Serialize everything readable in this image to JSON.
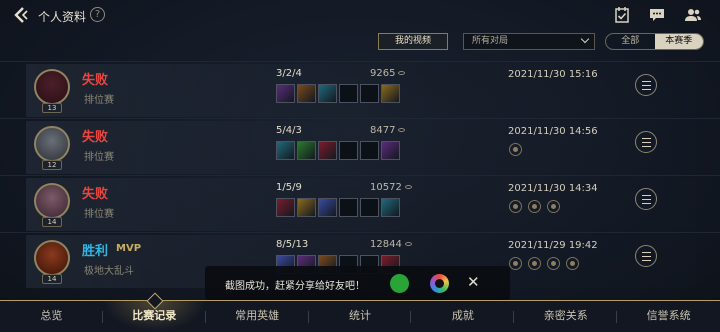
{
  "header": {
    "title": "个人资料",
    "help_icon": "?"
  },
  "top_icons": [
    "calendar-check-icon",
    "message-icon",
    "friends-icon"
  ],
  "filters": {
    "my_videos": "我的视频",
    "match_filter": "所有对局",
    "season_options": [
      "全部",
      "本赛季"
    ],
    "season_selected": "本赛季"
  },
  "matches": [
    {
      "result": "失败",
      "result_type": "loss",
      "mvp": "",
      "mode": "排位赛",
      "level": "13",
      "kda": "3/2/4",
      "gold": "9265",
      "date": "2021/11/30 15:16",
      "items_filled": 3,
      "rune_count": 0,
      "avatar_colors": [
        "#4b1f2a",
        "#2a0e14"
      ]
    },
    {
      "result": "失败",
      "result_type": "loss",
      "mvp": "",
      "mode": "排位赛",
      "level": "12",
      "kda": "5/4/3",
      "gold": "8477",
      "date": "2021/11/30 14:56",
      "items_filled": 3,
      "rune_count": 1,
      "avatar_colors": [
        "#6a6f77",
        "#2c3038"
      ]
    },
    {
      "result": "失败",
      "result_type": "loss",
      "mvp": "",
      "mode": "排位赛",
      "level": "14",
      "kda": "1/5/9",
      "gold": "10572",
      "date": "2021/11/30 14:34",
      "items_filled": 3,
      "rune_count": 3,
      "avatar_colors": [
        "#7a5a66",
        "#3a2430"
      ]
    },
    {
      "result": "胜利",
      "result_type": "win",
      "mvp": "MVP",
      "mode": "极地大乱斗",
      "level": "14",
      "kda": "8/5/13",
      "gold": "12844",
      "date": "2021/11/29 19:42",
      "items_filled": 3,
      "rune_count": 4,
      "avatar_colors": [
        "#8a3a1c",
        "#3a1208"
      ]
    }
  ],
  "toast": {
    "text": "截图成功，赶紧分享给好友吧！",
    "close": "✕"
  },
  "tabs": [
    "总览",
    "比赛记录",
    "常用英雄",
    "统计",
    "成就",
    "亲密关系",
    "信誉系统"
  ],
  "active_tab": "比赛记录",
  "colors": {
    "loss": "#e8463f",
    "win": "#2fb7e3",
    "gold_accent": "#b59e62"
  }
}
